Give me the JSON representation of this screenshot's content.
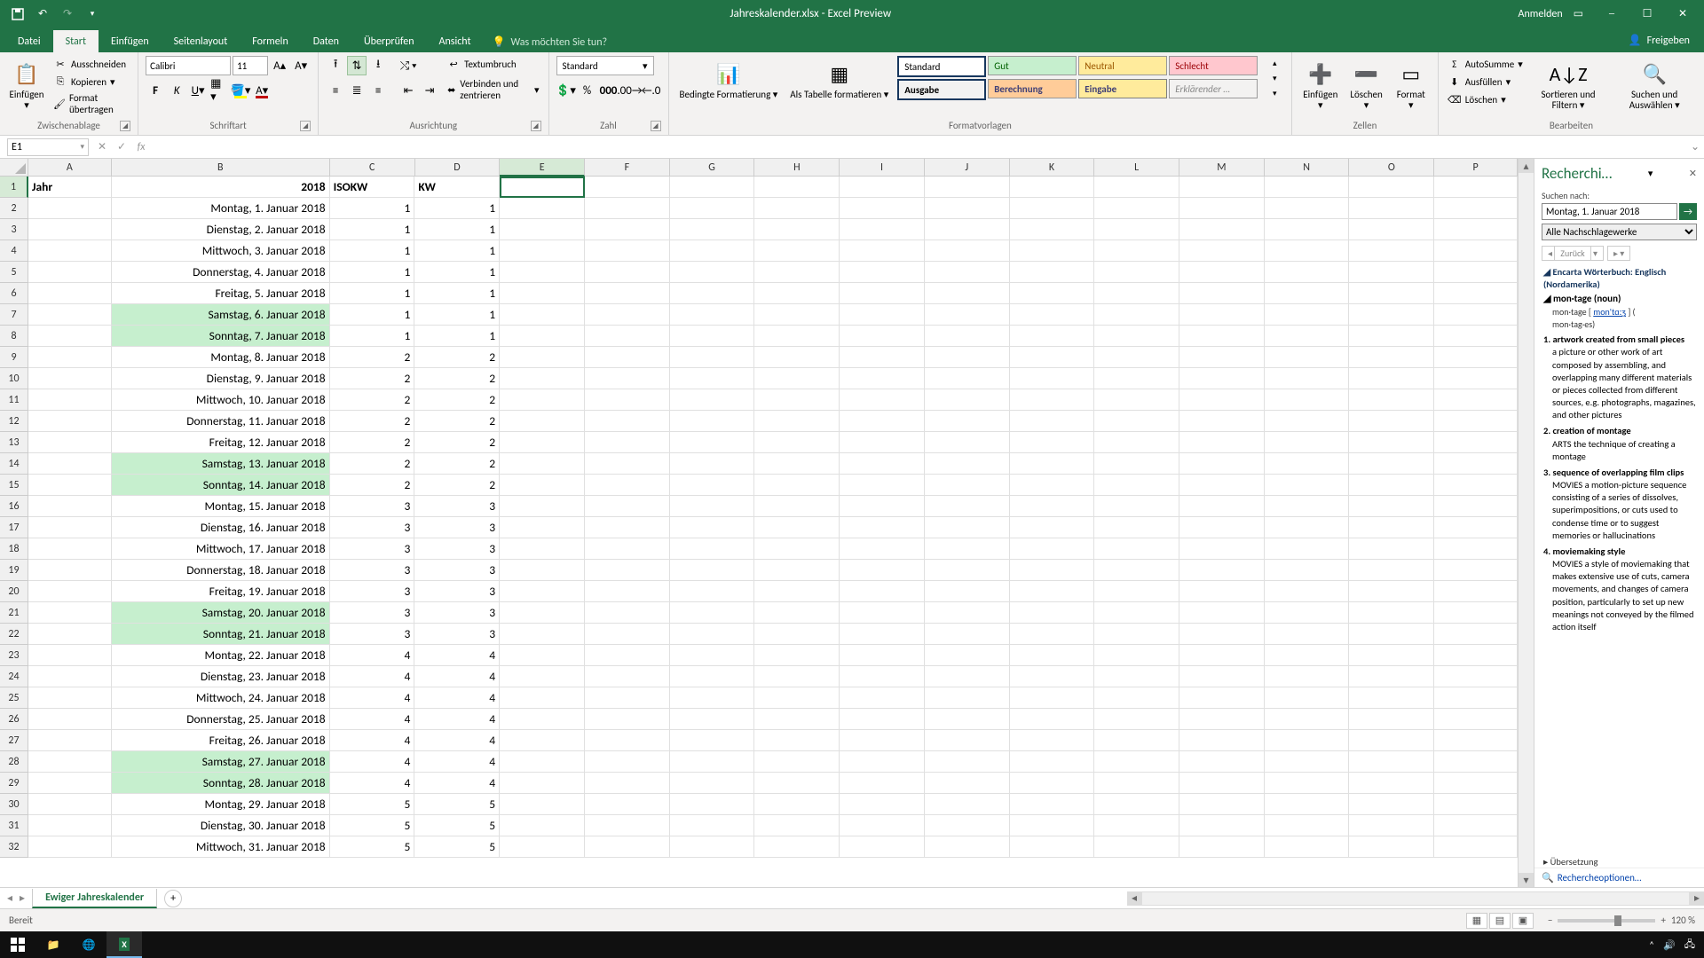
{
  "title": "Jahreskalender.xlsx - Excel Preview",
  "signin": "Anmelden",
  "share": "Freigeben",
  "tabs": [
    "Datei",
    "Start",
    "Einfügen",
    "Seitenlayout",
    "Formeln",
    "Daten",
    "Überprüfen",
    "Ansicht"
  ],
  "tellme": "Was möchten Sie tun?",
  "clipboard": {
    "paste": "Einfügen",
    "cut": "Ausschneiden",
    "copy": "Kopieren",
    "format": "Format übertragen",
    "label": "Zwischenablage"
  },
  "font": {
    "name": "Calibri",
    "size": "11",
    "label": "Schriftart"
  },
  "align": {
    "wrap": "Textumbruch",
    "merge": "Verbinden und zentrieren",
    "label": "Ausrichtung"
  },
  "number": {
    "format": "Standard",
    "label": "Zahl"
  },
  "styles": {
    "cond": "Bedingte Formatierung",
    "table": "Als Tabelle formatieren",
    "label": "Formatvorlagen",
    "standard": "Standard",
    "gut": "Gut",
    "neutral": "Neutral",
    "schlecht": "Schlecht",
    "ausgabe": "Ausgabe",
    "berechnung": "Berechnung",
    "eingabe": "Eingabe",
    "erkl": "Erklärender …"
  },
  "cells": {
    "insert": "Einfügen",
    "delete": "Löschen",
    "format": "Format",
    "label": "Zellen"
  },
  "editing": {
    "sum": "AutoSumme",
    "fill": "Ausfüllen",
    "clear": "Löschen",
    "sort": "Sortieren und Filtern",
    "find": "Suchen und Auswählen",
    "label": "Bearbeiten"
  },
  "namebox": "E1",
  "sheet": {
    "name": "Ewiger Jahreskalender"
  },
  "status": "Bereit",
  "zoom": "120 %",
  "columns": {
    "widths": [
      96,
      252,
      98,
      98,
      98,
      98,
      98,
      98,
      98,
      98,
      98,
      98,
      98,
      98,
      98,
      96
    ],
    "letters": [
      "A",
      "B",
      "C",
      "D",
      "E",
      "F",
      "G",
      "H",
      "I",
      "J",
      "K",
      "L",
      "M",
      "N",
      "O",
      "P"
    ],
    "selected": 4
  },
  "rows": {
    "header": [
      "Jahr",
      "2018",
      "ISOKW",
      "KW"
    ],
    "selected_row": 0,
    "selected_col": 4,
    "data": [
      {
        "d": "Montag, 1. Januar 2018",
        "i": "1",
        "k": "1",
        "w": false
      },
      {
        "d": "Dienstag, 2. Januar 2018",
        "i": "1",
        "k": "1",
        "w": false
      },
      {
        "d": "Mittwoch, 3. Januar 2018",
        "i": "1",
        "k": "1",
        "w": false
      },
      {
        "d": "Donnerstag, 4. Januar 2018",
        "i": "1",
        "k": "1",
        "w": false
      },
      {
        "d": "Freitag, 5. Januar 2018",
        "i": "1",
        "k": "1",
        "w": false
      },
      {
        "d": "Samstag, 6. Januar 2018",
        "i": "1",
        "k": "1",
        "w": true
      },
      {
        "d": "Sonntag, 7. Januar 2018",
        "i": "1",
        "k": "1",
        "w": true
      },
      {
        "d": "Montag, 8. Januar 2018",
        "i": "2",
        "k": "2",
        "w": false
      },
      {
        "d": "Dienstag, 9. Januar 2018",
        "i": "2",
        "k": "2",
        "w": false
      },
      {
        "d": "Mittwoch, 10. Januar 2018",
        "i": "2",
        "k": "2",
        "w": false
      },
      {
        "d": "Donnerstag, 11. Januar 2018",
        "i": "2",
        "k": "2",
        "w": false
      },
      {
        "d": "Freitag, 12. Januar 2018",
        "i": "2",
        "k": "2",
        "w": false
      },
      {
        "d": "Samstag, 13. Januar 2018",
        "i": "2",
        "k": "2",
        "w": true
      },
      {
        "d": "Sonntag, 14. Januar 2018",
        "i": "2",
        "k": "2",
        "w": true
      },
      {
        "d": "Montag, 15. Januar 2018",
        "i": "3",
        "k": "3",
        "w": false
      },
      {
        "d": "Dienstag, 16. Januar 2018",
        "i": "3",
        "k": "3",
        "w": false
      },
      {
        "d": "Mittwoch, 17. Januar 2018",
        "i": "3",
        "k": "3",
        "w": false
      },
      {
        "d": "Donnerstag, 18. Januar 2018",
        "i": "3",
        "k": "3",
        "w": false
      },
      {
        "d": "Freitag, 19. Januar 2018",
        "i": "3",
        "k": "3",
        "w": false
      },
      {
        "d": "Samstag, 20. Januar 2018",
        "i": "3",
        "k": "3",
        "w": true
      },
      {
        "d": "Sonntag, 21. Januar 2018",
        "i": "3",
        "k": "3",
        "w": true
      },
      {
        "d": "Montag, 22. Januar 2018",
        "i": "4",
        "k": "4",
        "w": false
      },
      {
        "d": "Dienstag, 23. Januar 2018",
        "i": "4",
        "k": "4",
        "w": false
      },
      {
        "d": "Mittwoch, 24. Januar 2018",
        "i": "4",
        "k": "4",
        "w": false
      },
      {
        "d": "Donnerstag, 25. Januar 2018",
        "i": "4",
        "k": "4",
        "w": false
      },
      {
        "d": "Freitag, 26. Januar 2018",
        "i": "4",
        "k": "4",
        "w": false
      },
      {
        "d": "Samstag, 27. Januar 2018",
        "i": "4",
        "k": "4",
        "w": true
      },
      {
        "d": "Sonntag, 28. Januar 2018",
        "i": "4",
        "k": "4",
        "w": true
      },
      {
        "d": "Montag, 29. Januar 2018",
        "i": "5",
        "k": "5",
        "w": false
      },
      {
        "d": "Dienstag, 30. Januar 2018",
        "i": "5",
        "k": "5",
        "w": false
      },
      {
        "d": "Mittwoch, 31. Januar 2018",
        "i": "5",
        "k": "5",
        "w": false
      }
    ]
  },
  "research": {
    "title": "Recherchi…",
    "search_label": "Suchen nach:",
    "search_value": "Montag, 1. Januar 2018",
    "scope": "Alle Nachschlagewerke",
    "back": "Zurück",
    "dict": "Encarta Wörterbuch: Englisch (Nordamerika)",
    "headword": "mon·tage (noun)",
    "phon1": "mon·tage [ ",
    "phon_link": "mon'tɑːʒ",
    "phon2": " ] (",
    "phon3": "mon·tag·es)",
    "senses": [
      {
        "n": "1. artwork created from small pieces",
        "d": "a picture or other work of art composed by assembling, and overlapping many different materials or pieces collected from different sources, e.g. photographs, magazines, and other pictures"
      },
      {
        "n": "2. creation of montage",
        "d": "ARTS the technique of creating a montage"
      },
      {
        "n": "3. sequence of overlapping film clips",
        "d": "MOVIES a motion-picture sequence consisting of a series of dissolves, superimpositions, or cuts used to condense time or to suggest memories or hallucinations"
      },
      {
        "n": "4. moviemaking style",
        "d": "MOVIES a style of moviemaking that makes extensive use of cuts, camera movements, and changes of camera position, particularly to set up new meanings not conveyed by the filmed action itself"
      }
    ],
    "trans": "Übersetzung",
    "options": "Rechercheoptionen…"
  }
}
